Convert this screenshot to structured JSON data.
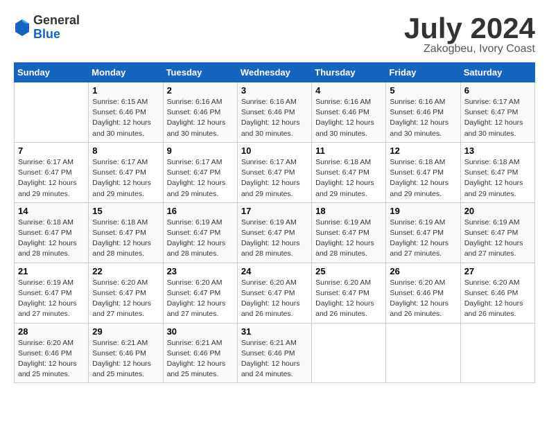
{
  "header": {
    "logo": {
      "general": "General",
      "blue": "Blue"
    },
    "title": "July 2024",
    "location": "Zakogbeu, Ivory Coast"
  },
  "calendar": {
    "columns": [
      "Sunday",
      "Monday",
      "Tuesday",
      "Wednesday",
      "Thursday",
      "Friday",
      "Saturday"
    ],
    "weeks": [
      [
        {
          "day": "",
          "info": ""
        },
        {
          "day": "1",
          "info": "Sunrise: 6:15 AM\nSunset: 6:46 PM\nDaylight: 12 hours\nand 30 minutes."
        },
        {
          "day": "2",
          "info": "Sunrise: 6:16 AM\nSunset: 6:46 PM\nDaylight: 12 hours\nand 30 minutes."
        },
        {
          "day": "3",
          "info": "Sunrise: 6:16 AM\nSunset: 6:46 PM\nDaylight: 12 hours\nand 30 minutes."
        },
        {
          "day": "4",
          "info": "Sunrise: 6:16 AM\nSunset: 6:46 PM\nDaylight: 12 hours\nand 30 minutes."
        },
        {
          "day": "5",
          "info": "Sunrise: 6:16 AM\nSunset: 6:46 PM\nDaylight: 12 hours\nand 30 minutes."
        },
        {
          "day": "6",
          "info": "Sunrise: 6:17 AM\nSunset: 6:47 PM\nDaylight: 12 hours\nand 30 minutes."
        }
      ],
      [
        {
          "day": "7",
          "info": "Sunrise: 6:17 AM\nSunset: 6:47 PM\nDaylight: 12 hours\nand 29 minutes."
        },
        {
          "day": "8",
          "info": "Sunrise: 6:17 AM\nSunset: 6:47 PM\nDaylight: 12 hours\nand 29 minutes."
        },
        {
          "day": "9",
          "info": "Sunrise: 6:17 AM\nSunset: 6:47 PM\nDaylight: 12 hours\nand 29 minutes."
        },
        {
          "day": "10",
          "info": "Sunrise: 6:17 AM\nSunset: 6:47 PM\nDaylight: 12 hours\nand 29 minutes."
        },
        {
          "day": "11",
          "info": "Sunrise: 6:18 AM\nSunset: 6:47 PM\nDaylight: 12 hours\nand 29 minutes."
        },
        {
          "day": "12",
          "info": "Sunrise: 6:18 AM\nSunset: 6:47 PM\nDaylight: 12 hours\nand 29 minutes."
        },
        {
          "day": "13",
          "info": "Sunrise: 6:18 AM\nSunset: 6:47 PM\nDaylight: 12 hours\nand 29 minutes."
        }
      ],
      [
        {
          "day": "14",
          "info": "Sunrise: 6:18 AM\nSunset: 6:47 PM\nDaylight: 12 hours\nand 28 minutes."
        },
        {
          "day": "15",
          "info": "Sunrise: 6:18 AM\nSunset: 6:47 PM\nDaylight: 12 hours\nand 28 minutes."
        },
        {
          "day": "16",
          "info": "Sunrise: 6:19 AM\nSunset: 6:47 PM\nDaylight: 12 hours\nand 28 minutes."
        },
        {
          "day": "17",
          "info": "Sunrise: 6:19 AM\nSunset: 6:47 PM\nDaylight: 12 hours\nand 28 minutes."
        },
        {
          "day": "18",
          "info": "Sunrise: 6:19 AM\nSunset: 6:47 PM\nDaylight: 12 hours\nand 28 minutes."
        },
        {
          "day": "19",
          "info": "Sunrise: 6:19 AM\nSunset: 6:47 PM\nDaylight: 12 hours\nand 27 minutes."
        },
        {
          "day": "20",
          "info": "Sunrise: 6:19 AM\nSunset: 6:47 PM\nDaylight: 12 hours\nand 27 minutes."
        }
      ],
      [
        {
          "day": "21",
          "info": "Sunrise: 6:19 AM\nSunset: 6:47 PM\nDaylight: 12 hours\nand 27 minutes."
        },
        {
          "day": "22",
          "info": "Sunrise: 6:20 AM\nSunset: 6:47 PM\nDaylight: 12 hours\nand 27 minutes."
        },
        {
          "day": "23",
          "info": "Sunrise: 6:20 AM\nSunset: 6:47 PM\nDaylight: 12 hours\nand 27 minutes."
        },
        {
          "day": "24",
          "info": "Sunrise: 6:20 AM\nSunset: 6:47 PM\nDaylight: 12 hours\nand 26 minutes."
        },
        {
          "day": "25",
          "info": "Sunrise: 6:20 AM\nSunset: 6:47 PM\nDaylight: 12 hours\nand 26 minutes."
        },
        {
          "day": "26",
          "info": "Sunrise: 6:20 AM\nSunset: 6:46 PM\nDaylight: 12 hours\nand 26 minutes."
        },
        {
          "day": "27",
          "info": "Sunrise: 6:20 AM\nSunset: 6:46 PM\nDaylight: 12 hours\nand 26 minutes."
        }
      ],
      [
        {
          "day": "28",
          "info": "Sunrise: 6:20 AM\nSunset: 6:46 PM\nDaylight: 12 hours\nand 25 minutes."
        },
        {
          "day": "29",
          "info": "Sunrise: 6:21 AM\nSunset: 6:46 PM\nDaylight: 12 hours\nand 25 minutes."
        },
        {
          "day": "30",
          "info": "Sunrise: 6:21 AM\nSunset: 6:46 PM\nDaylight: 12 hours\nand 25 minutes."
        },
        {
          "day": "31",
          "info": "Sunrise: 6:21 AM\nSunset: 6:46 PM\nDaylight: 12 hours\nand 24 minutes."
        },
        {
          "day": "",
          "info": ""
        },
        {
          "day": "",
          "info": ""
        },
        {
          "day": "",
          "info": ""
        }
      ]
    ]
  }
}
